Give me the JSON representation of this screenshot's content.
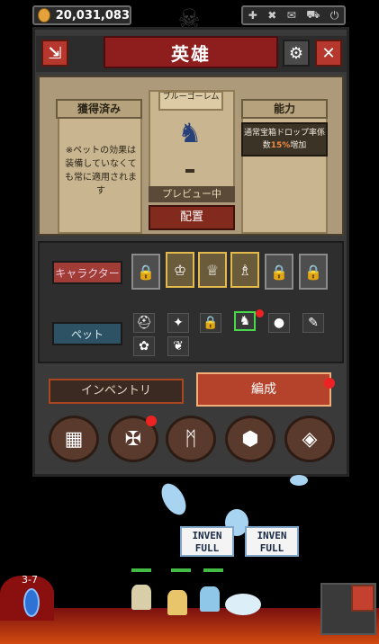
{
  "header": {
    "gold": "20,031,083"
  },
  "window": {
    "title": "英雄"
  },
  "info": {
    "acquired_label": "獲得済み",
    "pet_note": "※ペットの効果は装備していなくても常に適用されます",
    "pet_name": "ブルーゴーレム",
    "preview_label": "プレビュー中",
    "equip_label": "配置",
    "ability_label": "能力",
    "ability_text_prefix": "通常宝箱ドロップ率係数",
    "ability_percent": "15%",
    "ability_text_suffix": "増加"
  },
  "roster": {
    "character_tab": "キャラクター",
    "pet_tab": "ペット"
  },
  "subtabs": {
    "inventory": "インベントリ",
    "formation": "編成"
  },
  "scene": {
    "stage": "3-7",
    "bubble_lines": [
      "INVEN",
      "FULL"
    ]
  },
  "colors": {
    "accent": "#8e1d1d",
    "selected_pet": "#48d84a",
    "notify": "#e22222"
  }
}
